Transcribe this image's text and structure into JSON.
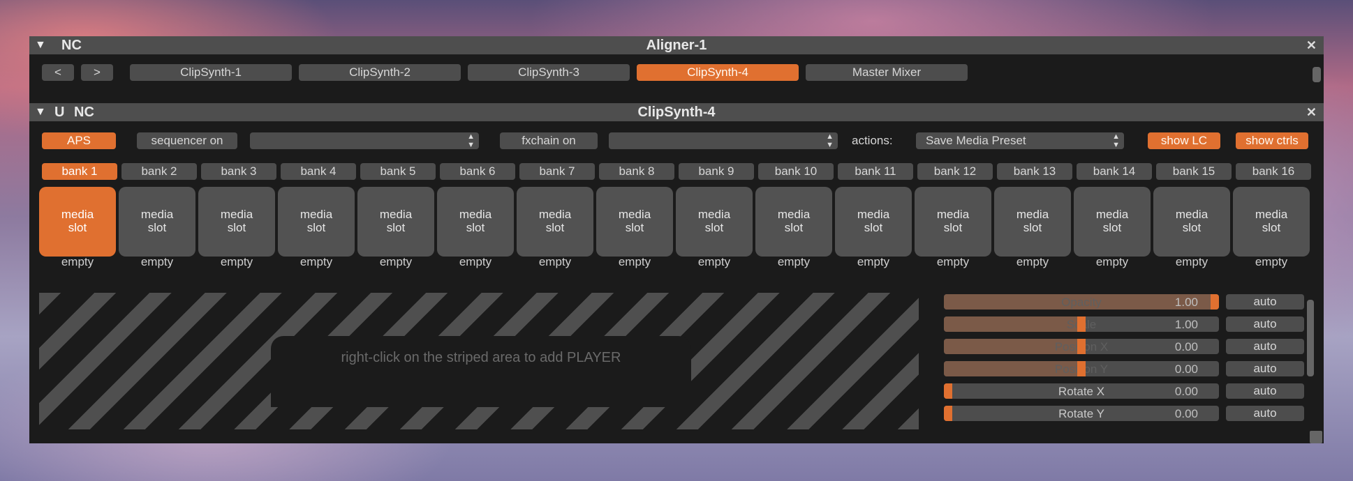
{
  "aligner": {
    "collapse_glyph": "▼",
    "nc_label": "NC",
    "title": "Aligner-1",
    "close_glyph": "✕",
    "nav_prev": "<",
    "nav_next": ">",
    "tabs": [
      "ClipSynth-1",
      "ClipSynth-2",
      "ClipSynth-3",
      "ClipSynth-4",
      "Master Mixer"
    ],
    "active_tab": "ClipSynth-4"
  },
  "clipsynth": {
    "collapse_glyph": "▼",
    "u_label": "U",
    "nc_label": "NC",
    "title": "ClipSynth-4",
    "close_glyph": "✕",
    "aps_label": "APS",
    "sequencer_label": "sequencer on",
    "sequencer_select": "",
    "fxchain_label": "fxchain on",
    "fxchain_select": "",
    "actions_label": "actions:",
    "actions_select": "Save Media Preset",
    "show_lc_label": "show LC",
    "show_ctrls_label": "show ctrls",
    "banks": [
      "bank 1",
      "bank 2",
      "bank 3",
      "bank 4",
      "bank 5",
      "bank 6",
      "bank 7",
      "bank 8",
      "bank 9",
      "bank 10",
      "bank 11",
      "bank 12",
      "bank 13",
      "bank 14",
      "bank 15",
      "bank 16"
    ],
    "active_bank": "bank 1",
    "slot_line1": "media",
    "slot_line2": "slot",
    "slot_state": "empty",
    "player_hint": "right-click on the striped area to add PLAYER",
    "params": [
      {
        "name": "Opacity",
        "value": "1.00",
        "level": 1.0,
        "auto": "auto"
      },
      {
        "name": "Scale",
        "value": "1.00",
        "level": 0.5,
        "auto": "auto"
      },
      {
        "name": "Position X",
        "value": "0.00",
        "level": 0.5,
        "auto": "auto"
      },
      {
        "name": "Position Y",
        "value": "0.00",
        "level": 0.5,
        "auto": "auto"
      },
      {
        "name": "Rotate X",
        "value": "0.00",
        "level": 0.0,
        "auto": "auto"
      },
      {
        "name": "Rotate Y",
        "value": "0.00",
        "level": 0.0,
        "auto": "auto"
      }
    ]
  },
  "colors": {
    "accent": "#e07030",
    "panel": "#1b1b1b",
    "titlebar": "#4e4e4e",
    "control": "#4d4d4d"
  }
}
